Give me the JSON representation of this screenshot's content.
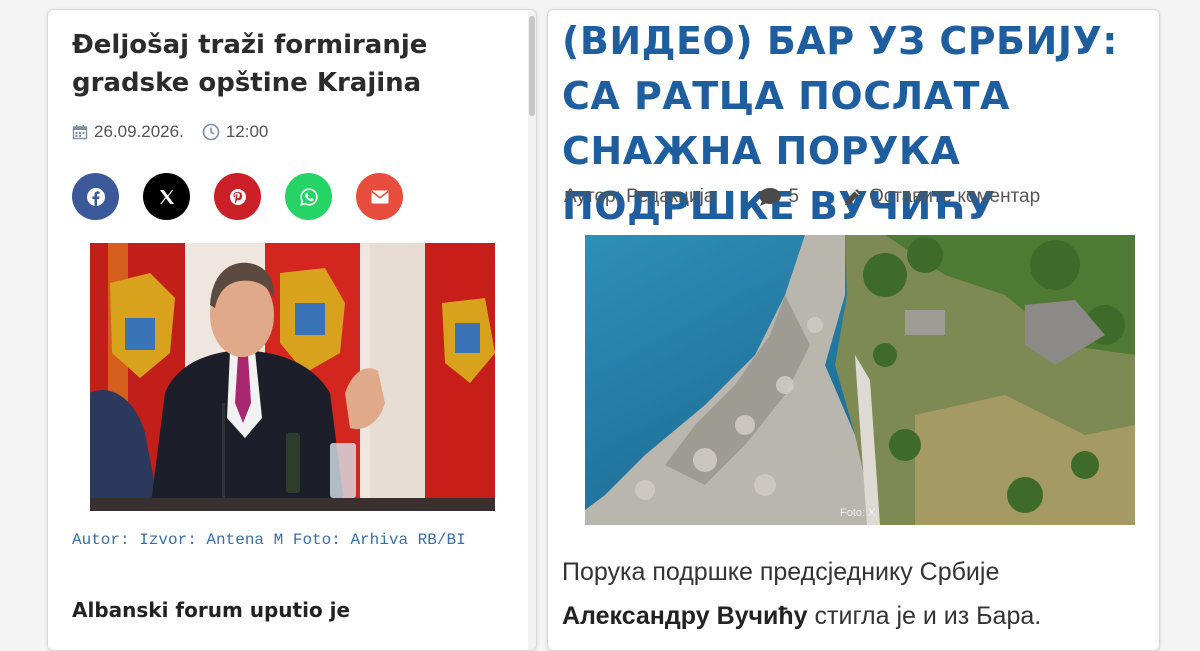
{
  "left_article": {
    "title": "Đeljošaj traži formiranje gradske opštine Krajina",
    "date": "26.09.2026.",
    "time": "12:00",
    "share_buttons": [
      {
        "name": "facebook",
        "icon": "facebook-icon",
        "color": "#3b5998"
      },
      {
        "name": "x",
        "icon": "x-icon",
        "color": "#000000"
      },
      {
        "name": "pinterest",
        "icon": "pinterest-icon",
        "color": "#cb2027"
      },
      {
        "name": "whatsapp",
        "icon": "whatsapp-icon",
        "color": "#25d366"
      },
      {
        "name": "email",
        "icon": "envelope-icon",
        "color": "#e74c3c"
      }
    ],
    "caption": "Autor: Izvor: Antena M Foto: Arhiva RB/BI",
    "lead": "Albanski forum uputio je"
  },
  "right_article": {
    "title": "(ВИДЕО) БАР УЗ СРБИЈУ: СА РАТЦА ПОСЛАТА СНАЖНА ПОРУКА ПОДРШКЕ ВУЧИЋУ",
    "author": "Аутор: Редакција",
    "comments_count": "5",
    "leave_comment": "Оставите коментар",
    "photo_credit": "Foto: X",
    "body_line1": "Порука подршке предсједнику Србије",
    "body_bold": "Александру Вучићу",
    "body_rest": " стигла је и из Бара."
  },
  "colors": {
    "right_title": "#1e5e9e",
    "caption": "#3a6ea5"
  }
}
